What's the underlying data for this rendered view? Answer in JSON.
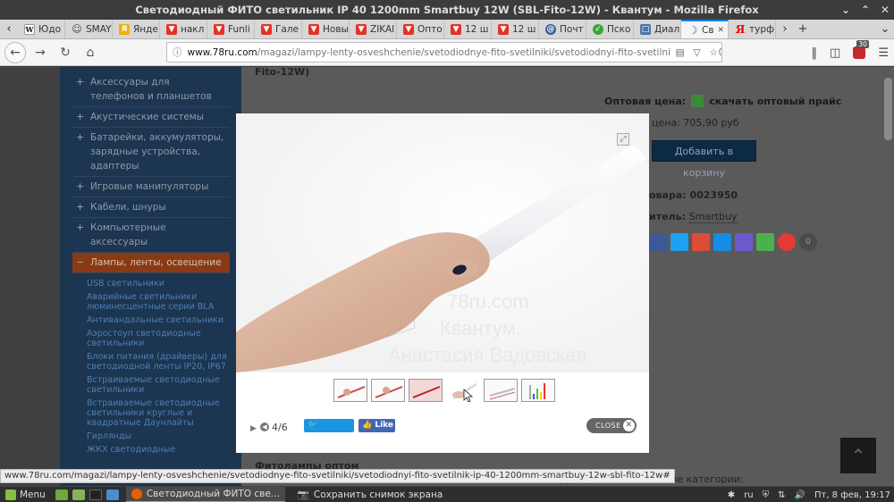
{
  "window": {
    "title": "Светодиодный ФИТО светильник IP 40 1200mm Smartbuy 12W (SBL-Fito-12W) - Квантум - Mozilla Firefox"
  },
  "tabs": [
    {
      "label": "Юдо",
      "icon": "wikipedia-icon"
    },
    {
      "label": "SMAY",
      "icon": "smile-icon"
    },
    {
      "label": "Янде",
      "icon": "yandex-icon"
    },
    {
      "label": "накл",
      "icon": "aliexpress-icon"
    },
    {
      "label": "Funli",
      "icon": "aliexpress-icon"
    },
    {
      "label": "Гале",
      "icon": "aliexpress-icon"
    },
    {
      "label": "Новы",
      "icon": "aliexpress-icon"
    },
    {
      "label": "ZIKAI",
      "icon": "aliexpress-icon"
    },
    {
      "label": "Опто",
      "icon": "aliexpress-icon"
    },
    {
      "label": "12 ш",
      "icon": "aliexpress-icon"
    },
    {
      "label": "12 ш",
      "icon": "aliexpress-icon"
    },
    {
      "label": "Почт",
      "icon": "mail-at-icon"
    },
    {
      "label": "Пско",
      "icon": "green-circle-icon"
    },
    {
      "label": "Диал",
      "icon": "chat-icon"
    },
    {
      "label": "Св",
      "icon": "moon-icon",
      "active": true
    },
    {
      "label": "турф",
      "icon": "yandex-red-icon"
    }
  ],
  "urlbar": {
    "host": "www.78ru.com",
    "path": "/magazi/lampy-lenty-osveshchenie/svetodiodnye-fito-svetilniki/svetodiodnyi-fito-svetilnik-ip-40-1200mm-..."
  },
  "extensions": {
    "badge_count": "30"
  },
  "sidebar": {
    "items": [
      {
        "label": "Аксессуары для телефонов и планшетов"
      },
      {
        "label": "Акустические системы"
      },
      {
        "label": "Батарейки, аккумуляторы, зарядные устройства, адаптеры"
      },
      {
        "label": "Игровые манипуляторы"
      },
      {
        "label": "Кабели, шнуры"
      },
      {
        "label": "Компьютерные аксессуары"
      },
      {
        "label": "Лампы, ленты, освещение",
        "open": true
      }
    ],
    "subitems": [
      "USB светильники",
      "Аварийные светильники люминесцентные серии BLA",
      "Антивандальные светильники",
      "Аэростоуп светодиодные светильники",
      "Блоки питания (драйверы) для светодиодной ленты IP20, IP67",
      "Встраиваемые светодиодные светильники",
      "Встраиваемые светодиодные светильники круглые и квадратные Даунлайты",
      "Гирлянды",
      "ЖКХ светодиодные"
    ]
  },
  "product": {
    "title_tail": "Fito-12W)",
    "wholesale_label": "Оптовая цена:",
    "wholesale_link": "скачать оптовый прайс",
    "price_label": "цена: 705,90 руб",
    "add_to_cart": "Добавить в корзину",
    "code_label": "овара: 0023950",
    "maker_label": "итель:",
    "maker": "Smartbuy",
    "share_count": "0",
    "section_title": "Фитолампы оптом",
    "section_tail": "подразделяются на такие категории:"
  },
  "lightbox": {
    "counter": "4/6",
    "tweet_label": "Твитнуть",
    "like_label": "Like 0",
    "close_label": "CLOSE",
    "watermark_lines": [
      "78ru.com",
      "Квантум.",
      "Анастасия Вадовская"
    ],
    "thumbnail_count": 6,
    "active_thumbnail": 4
  },
  "status_url": "www.78ru.com/magazi/lampy-lenty-osveshchenie/svetodiodnye-fito-svetilniki/svetodiodnyi-fito-svetilnik-ip-40-1200mm-smartbuy-12w-sbl-fito-12w#",
  "taskbar": {
    "menu_label": "Menu",
    "tasks": [
      {
        "label": "Светодиодный ФИТО свe...",
        "active": true
      },
      {
        "label": "Сохранить снимок экрана",
        "active": false
      }
    ],
    "keyboard_layout": "ru",
    "datetime": "Пт, 8 фев, 19:17"
  },
  "colors": {
    "accent_tab": "#0a84ff",
    "sidebar_bg": "#1c3550",
    "sidebar_open": "#8a3a12",
    "cart_button": "#0d2a44",
    "tweet_button": "#1b95e0",
    "like_button": "#4267b2",
    "mint_green": "#86be43"
  }
}
